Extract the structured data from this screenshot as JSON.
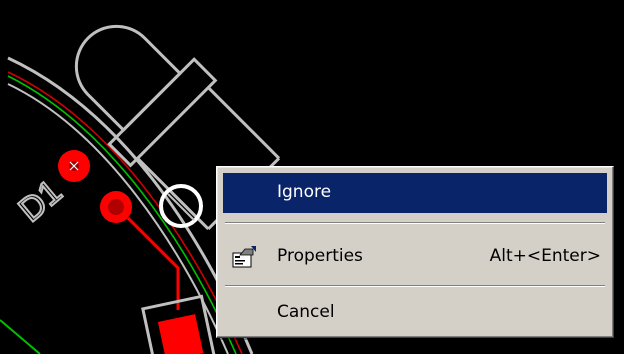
{
  "context_menu": {
    "items": [
      {
        "label": "Ignore",
        "shortcut": "",
        "selected": true
      },
      {
        "label": "Properties",
        "shortcut": "Alt+<Enter>",
        "icon": "properties-icon"
      },
      {
        "label": "Cancel",
        "shortcut": ""
      }
    ]
  },
  "pcb": {
    "designator": "D1"
  },
  "colors": {
    "background": "#000000",
    "silkscreen": "#c0c0c0",
    "pad": "#ff0000",
    "menu_bg": "#d4d0c8",
    "selection": "#0a246a",
    "track_green": "#00c000"
  }
}
